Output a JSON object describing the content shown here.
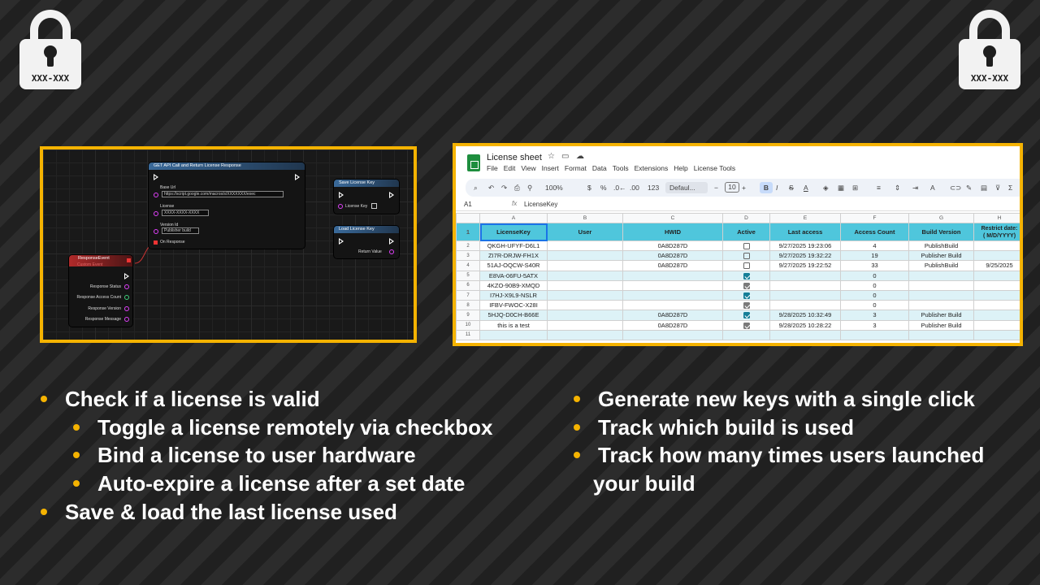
{
  "locks": {
    "left_code": "XXX-XXX",
    "right_code": "XXX-XXX",
    "icon": "padlock-icon"
  },
  "blueprint": {
    "get_node": {
      "title": "GET API Call and Return License Response",
      "base_url_label": "Base Url",
      "base_url_value": "https://script.google.com/macros/s/XXXXXXX/exec",
      "license_label": "License",
      "license_value": "XXXX-XXXX-XXXX",
      "version_label": "Version Id",
      "version_value": "Publisher build",
      "on_response": "On Response"
    },
    "save_node": {
      "title": "Save License Key",
      "license_key_label": "License Key"
    },
    "load_node": {
      "title": "Load License Key",
      "return_label": "Return Value"
    },
    "event_node": {
      "title": "ResponseEvent",
      "subtitle": "Custom Event",
      "pins": [
        "Response Status",
        "Response Access Count",
        "Response Version",
        "Response Message"
      ]
    }
  },
  "sheet": {
    "title": "License sheet",
    "menu": [
      "File",
      "Edit",
      "View",
      "Insert",
      "Format",
      "Data",
      "Tools",
      "Extensions",
      "Help",
      "License Tools"
    ],
    "toolbar": {
      "zoom": "100%",
      "currency": "$",
      "percent": "%",
      "dec_less": ".0←",
      "dec_more": ".00",
      "num_format": "123",
      "font": "Defaul...",
      "font_size": "10",
      "bold": "B",
      "italic": "I"
    },
    "cell_ref": "A1",
    "fx": "fx",
    "formula_value": "LicenseKey",
    "col_letters": [
      "A",
      "B",
      "C",
      "D",
      "E",
      "F",
      "G",
      "H"
    ],
    "headers": [
      "LicenseKey",
      "User",
      "HWID",
      "Active",
      "Last access",
      "Access Count",
      "Build Version",
      "Restrict date:\n( M/D/YYYY)"
    ],
    "rows": [
      {
        "n": "2",
        "key": "QKGH-UFYF-D6L1",
        "user": "",
        "hwid": "0A8D287D",
        "active": "off",
        "last": "9/27/2025 19:23:06",
        "count": "4",
        "build": "PublishBuild",
        "restrict": ""
      },
      {
        "n": "3",
        "key": "ZI7R-DRJW-FH1X",
        "user": "",
        "hwid": "0A8D287D",
        "active": "off",
        "last": "9/27/2025 19:32:22",
        "count": "19",
        "build": "Publisher Build",
        "restrict": ""
      },
      {
        "n": "4",
        "key": "51AJ-OQCW-S40R",
        "user": "",
        "hwid": "0A8D287D",
        "active": "off",
        "last": "9/27/2025 19:22:52",
        "count": "33",
        "build": "PublishBuild",
        "restrict": "9/25/2025"
      },
      {
        "n": "5",
        "key": "E8VA-06FU-5ATX",
        "user": "",
        "hwid": "",
        "active": "teal",
        "last": "",
        "count": "0",
        "build": "",
        "restrict": ""
      },
      {
        "n": "6",
        "key": "4KZO-90B9-XMQD",
        "user": "",
        "hwid": "",
        "active": "gray",
        "last": "",
        "count": "0",
        "build": "",
        "restrict": ""
      },
      {
        "n": "7",
        "key": "I7HJ-X9L9-NSLR",
        "user": "",
        "hwid": "",
        "active": "teal",
        "last": "",
        "count": "0",
        "build": "",
        "restrict": ""
      },
      {
        "n": "8",
        "key": "IFBV-FWOC-X28I",
        "user": "",
        "hwid": "",
        "active": "gray",
        "last": "",
        "count": "0",
        "build": "",
        "restrict": ""
      },
      {
        "n": "9",
        "key": "5HJQ-D0CH-B66E",
        "user": "",
        "hwid": "0A8D287D",
        "active": "teal",
        "last": "9/28/2025 10:32:49",
        "count": "3",
        "build": "Publisher Build",
        "restrict": ""
      },
      {
        "n": "10",
        "key": "this is a test",
        "user": "",
        "hwid": "0A8D287D",
        "active": "gray",
        "last": "9/28/2025 10:28:22",
        "count": "3",
        "build": "Publisher Build",
        "restrict": ""
      },
      {
        "n": "11",
        "key": "",
        "user": "",
        "hwid": "",
        "active": "",
        "last": "",
        "count": "",
        "build": "",
        "restrict": ""
      }
    ]
  },
  "features_left": [
    {
      "text": "Check if a license is valid",
      "level": 0
    },
    {
      "text": "Toggle a license remotely via checkbox",
      "level": 1
    },
    {
      "text": "Bind a license to user hardware",
      "level": 1
    },
    {
      "text": "Auto-expire a license after a set date",
      "level": 1
    },
    {
      "text": "Save & load the last license used",
      "level": 0
    }
  ],
  "features_right": [
    {
      "text": "Generate new keys with a single click",
      "cont": false
    },
    {
      "text": "Track which build is used",
      "cont": false
    },
    {
      "text": "Track how many times users launched",
      "cont": false
    },
    {
      "text": "your build",
      "cont": true
    }
  ],
  "colors": {
    "accent": "#f5b301",
    "header_cyan": "#4fc6dc",
    "alt_row": "#ddf2f7"
  }
}
